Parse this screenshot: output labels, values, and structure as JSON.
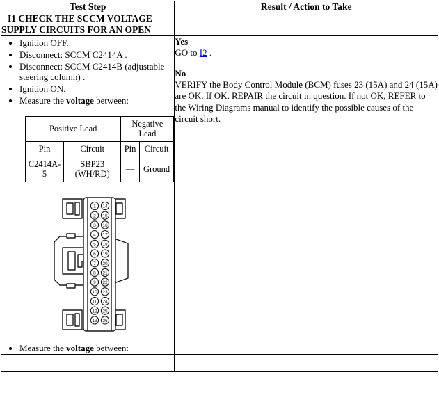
{
  "table": {
    "headers": {
      "test_step": "Test Step",
      "result_action": "Result / Action to Take"
    },
    "step_title": {
      "line1": "I1 CHECK THE SCCM VOLTAGE",
      "line2": "SUPPLY CIRCUITS FOR AN OPEN"
    }
  },
  "steps": [
    "Ignition OFF.",
    "Disconnect: SCCM C2414A .",
    "Disconnect: SCCM C2414B (adjustable steering column) .",
    "Ignition ON."
  ],
  "measure_step": {
    "prefix": "Measure the ",
    "bold": "voltage",
    "suffix": " between:"
  },
  "lead_table": {
    "group_headers": {
      "positive": "Positive Lead",
      "negative": "Negative Lead"
    },
    "column_headers": {
      "pin_pos": "Pin",
      "circuit_pos": "Circuit",
      "pin_neg": "Pin",
      "circuit_neg": "Circuit"
    },
    "rows": [
      {
        "pin_pos": "C2414A-5",
        "circuit_pos_line1": "SBP23",
        "circuit_pos_line2": "(WH/RD)",
        "pin_neg": "—",
        "circuit_neg": "Ground"
      }
    ]
  },
  "connector": {
    "name": "connector-pinout-diagram",
    "left_column_pins": [
      1,
      2,
      3,
      4,
      5,
      6,
      7,
      8,
      9,
      10,
      11,
      12,
      13
    ],
    "right_column_pins": [
      14,
      15,
      16,
      17,
      18,
      19,
      20,
      21,
      22,
      23,
      24,
      25,
      26
    ]
  },
  "result": {
    "yes_label": "Yes",
    "yes_text_before": "GO to ",
    "yes_link": "I2",
    "yes_text_after": " .",
    "no_label": "No",
    "no_text": "VERIFY the Body Control Module (BCM) fuses 23 (15A) and 24 (15A) are OK. If OK, REPAIR the circuit in question. If not OK, REFER to the Wiring Diagrams manual to identify the possible causes of the circuit short."
  },
  "colors": {
    "link": "#0000cc",
    "border": "#000000",
    "background": "#ffffff"
  }
}
